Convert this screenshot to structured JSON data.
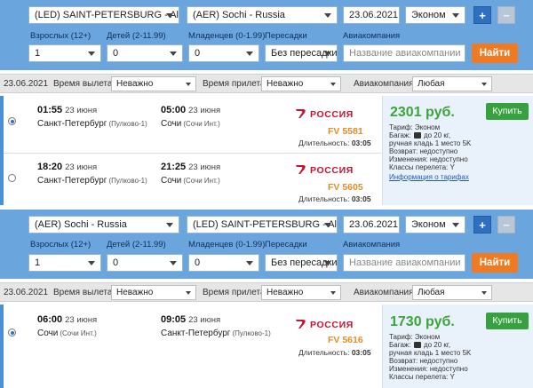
{
  "search1": {
    "from": "(LED) SAINT-PETERSBURG - All airp",
    "to": "(AER) Sochi - Russia",
    "date": "23.06.2021",
    "class": "Эконом",
    "plus": "+",
    "minus": "−",
    "labels": {
      "adults": "Взрослых (12+)",
      "children": "Детей (2-11.99)",
      "infants": "Младенцев (0-1.99)",
      "transfers": "Пересадки",
      "airline": "Авиакомпания"
    },
    "adults": "1",
    "children": "0",
    "infants": "0",
    "transfers": "Без пересадки",
    "airline_placeholder": "Название авиакомпании",
    "find": "Найти"
  },
  "filter1": {
    "date": "23.06.2021",
    "dep_label": "Время вылета",
    "dep_value": "Неважно",
    "arr_label": "Время прилета",
    "arr_value": "Неважно",
    "airline_label": "Авиакомпания",
    "airline_value": "Любая"
  },
  "results1": {
    "flights": [
      {
        "dep_time": "01:55",
        "dep_date": "23 июня",
        "from_city": "Санкт-Петербург",
        "from_airport": "(Пулково-1)",
        "arr_time": "05:00",
        "arr_date": "23 июня",
        "to_city": "Сочи",
        "to_airport": "(Сочи Инт.)",
        "airline": "РОССИЯ",
        "flight_no": "FV 5581",
        "duration_label": "Длительность:",
        "duration": "03:05",
        "selected": true
      },
      {
        "dep_time": "18:20",
        "dep_date": "23 июня",
        "from_city": "Санкт-Петербург",
        "from_airport": "(Пулково-1)",
        "arr_time": "21:25",
        "arr_date": "23 июня",
        "to_city": "Сочи",
        "to_airport": "(Сочи Инт.)",
        "airline": "РОССИЯ",
        "flight_no": "FV 5605",
        "duration_label": "Длительность:",
        "duration": "03:05",
        "selected": false
      }
    ],
    "price": "2301 руб.",
    "buy": "Купить",
    "tariff": {
      "fare": "Тариф: Эконом",
      "baggage_prefix": "Багаж:",
      "baggage_suffix": "до 20 кг,",
      "carry_on": "ручная кладь 1 место 5K",
      "refund": "Возврат: недоступно",
      "changes": "Изменения: недоступно",
      "classes": "Классы перелета: Y",
      "link": "Информация о тарифах"
    }
  },
  "search2": {
    "from": "(AER) Sochi - Russia",
    "to": "(LED) SAINT-PETERSBURG - All airp",
    "date": "23.06.2021",
    "class": "Эконом",
    "plus": "+",
    "minus": "−",
    "labels": {
      "adults": "Взрослых (12+)",
      "children": "Детей (2-11.99)",
      "infants": "Младенцев (0-1.99)",
      "transfers": "Пересадки",
      "airline": "Авиакомпания"
    },
    "adults": "1",
    "children": "0",
    "infants": "0",
    "transfers": "Без пересадки",
    "airline_placeholder": "Название авиакомпании",
    "find": "Найти"
  },
  "filter2": {
    "date": "23.06.2021",
    "dep_label": "Время вылета",
    "dep_value": "Неважно",
    "arr_label": "Время прилета",
    "arr_value": "Неважно",
    "airline_label": "Авиакомпания",
    "airline_value": "Любая"
  },
  "results2": {
    "flights": [
      {
        "dep_time": "06:00",
        "dep_date": "23 июня",
        "from_city": "Сочи",
        "from_airport": "(Сочи Инт.)",
        "arr_time": "09:05",
        "arr_date": "23 июня",
        "to_city": "Санкт-Петербург",
        "to_airport": "(Пулково-1)",
        "airline": "РОССИЯ",
        "flight_no": "FV 5616",
        "duration_label": "Длительность:",
        "duration": "03:05",
        "selected": true
      }
    ],
    "price": "1730 руб.",
    "buy": "Купить",
    "tariff": {
      "fare": "Тариф: Эконом",
      "baggage_prefix": "Багаж:",
      "baggage_suffix": "до 20 кг,",
      "carry_on": "ручная кладь 1 место 5K",
      "refund": "Возврат: недоступно",
      "changes": "Изменения: недоступно",
      "classes": "Классы перелета: Y"
    }
  },
  "colors": {
    "panel": "#6aa5dd",
    "price": "#3ba53b",
    "buy": "#38a13f",
    "find": "#f07a22",
    "flight_no": "#e58c2a",
    "airline_logo": "#c4122f",
    "link": "#2358b8"
  },
  "icons": [
    "chevron-down-icon",
    "plus-icon",
    "minus-icon",
    "radio-icon",
    "rossiya-logo-icon",
    "baggage-icon"
  ]
}
